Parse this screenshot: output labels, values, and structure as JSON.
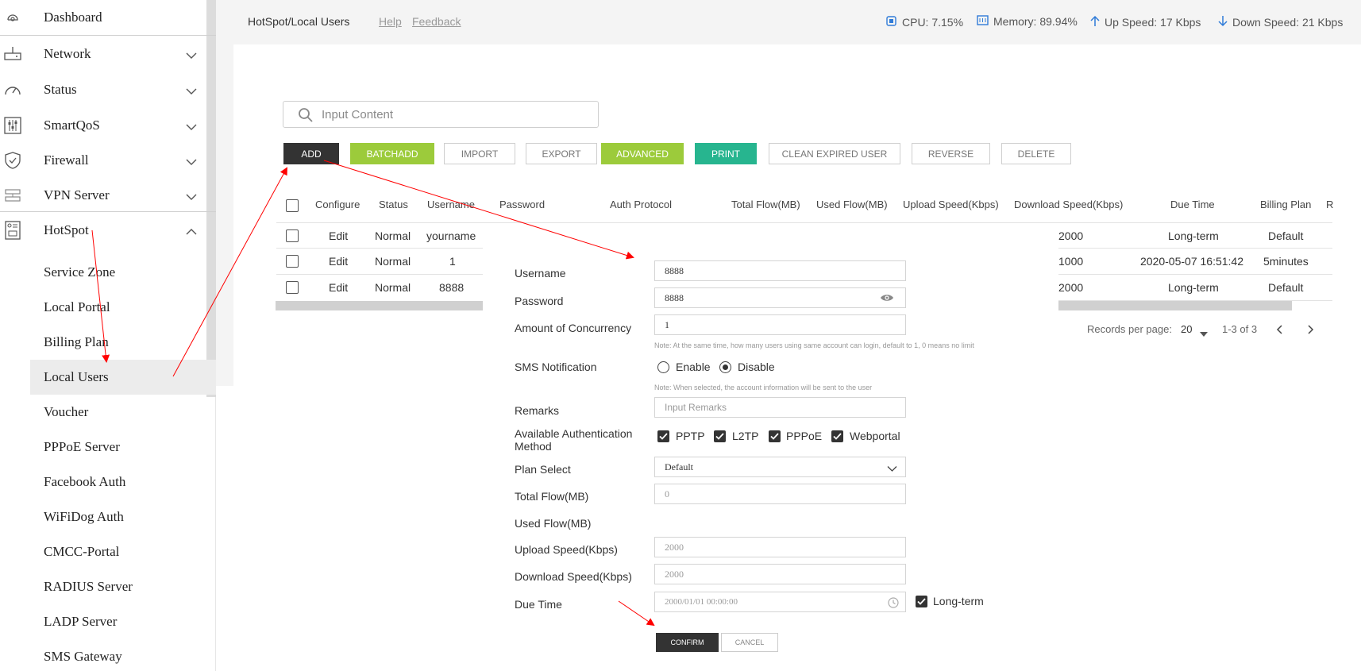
{
  "sidebar": {
    "items": [
      {
        "label": "Dashboard",
        "icon": "dashboard-icon"
      },
      {
        "label": "Network",
        "icon": "router-icon"
      },
      {
        "label": "Status",
        "icon": "gauge-icon"
      },
      {
        "label": "SmartQoS",
        "icon": "sliders-icon"
      },
      {
        "label": "Firewall",
        "icon": "shield-icon"
      },
      {
        "label": "VPN Server",
        "icon": "server-icon"
      },
      {
        "label": "HotSpot",
        "icon": "hotspot-icon"
      }
    ],
    "sub_items": [
      {
        "label": "Service Zone"
      },
      {
        "label": "Local Portal"
      },
      {
        "label": "Billing Plan"
      },
      {
        "label": "Local Users"
      },
      {
        "label": "Voucher"
      },
      {
        "label": "PPPoE Server"
      },
      {
        "label": "Facebook Auth"
      },
      {
        "label": "WiFiDog Auth"
      },
      {
        "label": "CMCC-Portal"
      },
      {
        "label": "RADIUS Server"
      },
      {
        "label": "LADP Server"
      },
      {
        "label": "SMS Gateway"
      }
    ]
  },
  "header": {
    "breadcrumb": "HotSpot/Local Users",
    "help": "Help",
    "feedback": "Feedback",
    "cpu": "CPU: 7.15%",
    "memory": "Memory: 89.94%",
    "up_speed": "Up Speed: 17 Kbps",
    "down_speed": "Down Speed: 21 Kbps"
  },
  "search": {
    "placeholder": "Input Content"
  },
  "toolbar": {
    "add": "ADD",
    "batchadd": "BATCHADD",
    "import": "IMPORT",
    "export": "EXPORT",
    "advanced": "ADVANCED",
    "print": "PRINT",
    "clean": "CLEAN EXPIRED USER",
    "reverse": "REVERSE",
    "delete": "DELETE"
  },
  "table": {
    "headers": {
      "configure": "Configure",
      "status": "Status",
      "username": "Username",
      "password": "Password",
      "auth": "Auth Protocol",
      "total_flow": "Total Flow(MB)",
      "used_flow": "Used Flow(MB)",
      "upload": "Upload Speed(Kbps)",
      "download": "Download Speed(Kbps)",
      "due": "Due Time",
      "billing": "Billing Plan",
      "extra": "R"
    },
    "rows": [
      {
        "configure": "Edit",
        "status": "Normal",
        "username": "yourname",
        "download": "2000",
        "due": "Long-term",
        "billing": "Default"
      },
      {
        "configure": "Edit",
        "status": "Normal",
        "username": "1",
        "download": "1000",
        "due": "2020-05-07 16:51:42",
        "billing": "5minutes"
      },
      {
        "configure": "Edit",
        "status": "Normal",
        "username": "8888",
        "download": "2000",
        "due": "Long-term",
        "billing": "Default"
      }
    ],
    "pager": {
      "label": "Records per page:",
      "per_page": "20",
      "range": "1-3 of 3"
    }
  },
  "form": {
    "username_label": "Username",
    "username_value": "8888",
    "password_label": "Password",
    "password_value": "8888",
    "concurrency_label": "Amount of Concurrency",
    "concurrency_value": "1",
    "concurrency_note": "Note: At the same time, how many users using same account can login, default to 1, 0 means no limit",
    "sms_label": "SMS Notification",
    "sms_enable": "Enable",
    "sms_disable": "Disable",
    "sms_note": "Note: When selected, the account information will be sent to the user",
    "remarks_label": "Remarks",
    "remarks_placeholder": "Input Remarks",
    "auth_label_1": "Available Authentication",
    "auth_label_2": "Method",
    "auth_pptp": "PPTP",
    "auth_l2tp": "L2TP",
    "auth_pppoe": "PPPoE",
    "auth_webportal": "Webportal",
    "plan_label": "Plan Select",
    "plan_value": "Default",
    "total_flow_label": "Total Flow(MB)",
    "total_flow_value": "0",
    "used_flow_label": "Used Flow(MB)",
    "upload_label": "Upload Speed(Kbps)",
    "upload_value": "2000",
    "download_label": "Download Speed(Kbps)",
    "download_value": "2000",
    "due_label": "Due Time",
    "due_value": "2000/01/01 00:00:00",
    "long_term": "Long-term",
    "confirm": "CONFIRM",
    "cancel": "CANCEL"
  },
  "colors": {
    "accent_green": "#9ccb3b",
    "accent_teal": "#27b58f",
    "dark": "#333333",
    "link_blue": "#2f7bd8",
    "arrow_red": "#ff0000"
  }
}
